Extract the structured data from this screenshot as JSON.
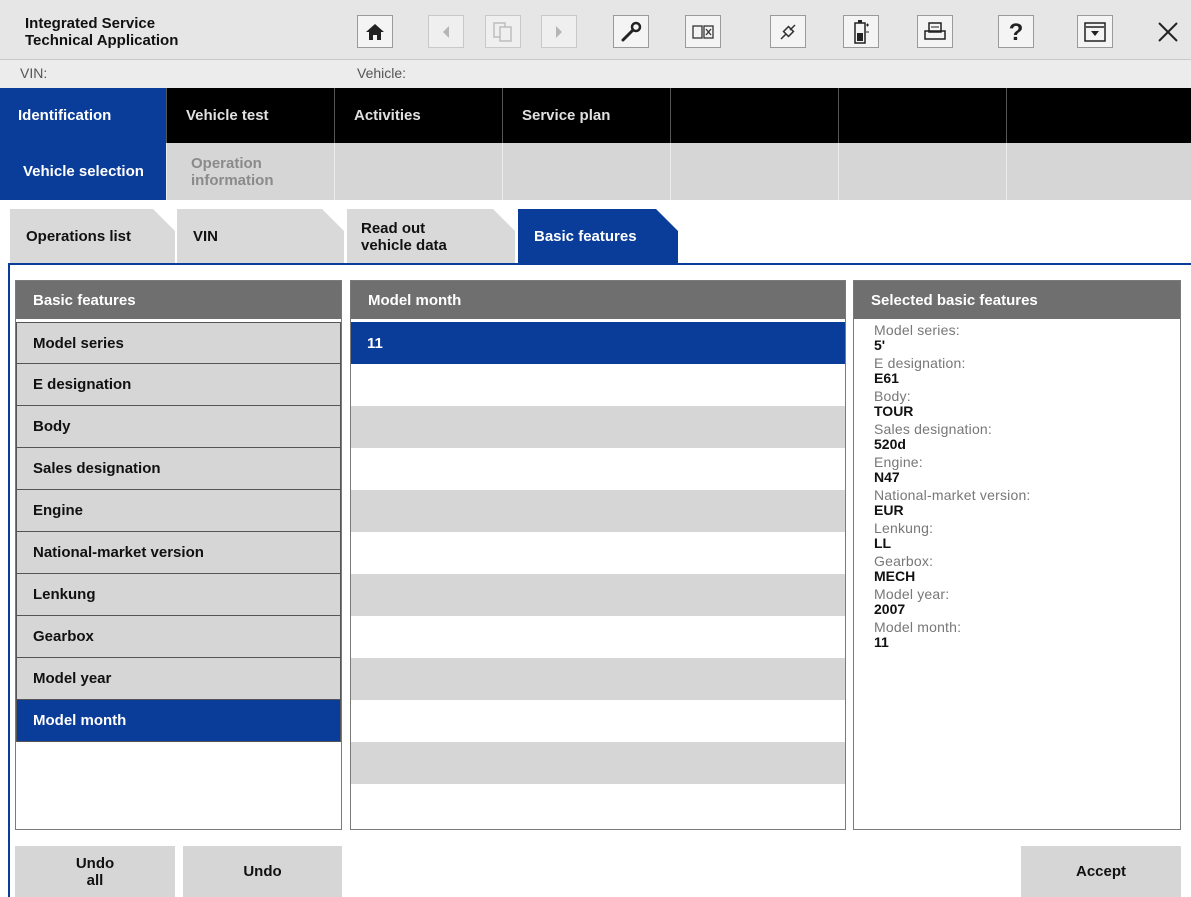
{
  "app": {
    "title_line1": "Integrated Service",
    "title_line2": "Technical Application"
  },
  "toolbar": {
    "buttons": [
      {
        "name": "home-button",
        "icon": "home-icon",
        "enabled": true
      },
      {
        "name": "back-button",
        "icon": "arrow-left-icon",
        "enabled": false
      },
      {
        "name": "documents-button",
        "icon": "documents-icon",
        "enabled": false
      },
      {
        "name": "forward-button",
        "icon": "arrow-right-icon",
        "enabled": false
      },
      {
        "name": "workshop-button",
        "icon": "wrench-icon",
        "enabled": true
      },
      {
        "name": "display-button",
        "icon": "window-icon",
        "enabled": true
      },
      {
        "name": "connection-button",
        "icon": "plug-icon",
        "enabled": true
      },
      {
        "name": "battery-button",
        "icon": "battery-icon",
        "enabled": true
      },
      {
        "name": "print-button",
        "icon": "printer-icon",
        "enabled": true
      },
      {
        "name": "help-button",
        "icon": "question-icon",
        "enabled": true
      },
      {
        "name": "minimize-button",
        "icon": "minimize-icon",
        "enabled": true
      },
      {
        "name": "close-button",
        "icon": "close-icon",
        "enabled": true
      }
    ]
  },
  "info": {
    "vin_label": "VIN:",
    "vehicle_label": "Vehicle:"
  },
  "main_nav": {
    "tabs": [
      "Identification",
      "Vehicle test",
      "Activities",
      "Service plan",
      "",
      "",
      ""
    ],
    "active_index": 0
  },
  "sub_nav": {
    "tabs": [
      "Vehicle selection",
      "Operation information",
      "",
      "",
      "",
      "",
      ""
    ],
    "active_index": 0
  },
  "folder_tabs": {
    "tabs": [
      "Operations list",
      "VIN",
      "Read out vehicle data",
      "Basic features"
    ],
    "active_index": 3
  },
  "features_panel": {
    "header": "Basic features",
    "items": [
      "Model series",
      "E designation",
      "Body",
      "Sales designation",
      "Engine",
      "National-market version",
      "Lenkung",
      "Gearbox",
      "Model year",
      "Model month"
    ],
    "active_index": 9
  },
  "month_panel": {
    "header": "Model month",
    "rows": [
      "11",
      "",
      "",
      "",
      "",
      "",
      "",
      "",
      "",
      "",
      "",
      ""
    ],
    "selected_index": 0
  },
  "selected_panel": {
    "header": "Selected basic features",
    "entries": [
      {
        "label": "Model series:",
        "value": "5'"
      },
      {
        "label": "E designation:",
        "value": "E61"
      },
      {
        "label": "Body:",
        "value": "TOUR"
      },
      {
        "label": "Sales designation:",
        "value": "520d"
      },
      {
        "label": "Engine:",
        "value": "N47"
      },
      {
        "label": "National-market version:",
        "value": "EUR"
      },
      {
        "label": "Lenkung:",
        "value": "LL"
      },
      {
        "label": "Gearbox:",
        "value": "MECH"
      },
      {
        "label": "Model year:",
        "value": "2007"
      },
      {
        "label": "Model month:",
        "value": "11"
      }
    ]
  },
  "buttons": {
    "undo_all_line1": "Undo",
    "undo_all_line2": "all",
    "undo": "Undo",
    "accept": "Accept"
  },
  "colors": {
    "accent": "#0a3c9a",
    "nav_bg": "#000000",
    "header_gray": "#6f6f6f",
    "item_gray": "#d6d6d6"
  }
}
